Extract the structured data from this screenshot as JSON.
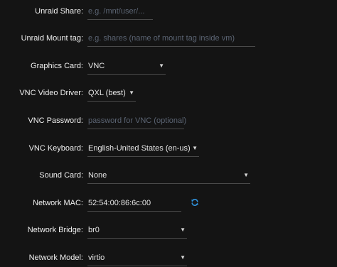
{
  "form": {
    "unraid_share": {
      "label": "Unraid Share:",
      "placeholder": "e.g. /mnt/user/..."
    },
    "unraid_mount_tag": {
      "label": "Unraid Mount tag:",
      "placeholder": "e.g. shares (name of mount tag inside vm)"
    },
    "graphics_card": {
      "label": "Graphics Card:",
      "value": "VNC"
    },
    "vnc_video_driver": {
      "label": "VNC Video Driver:",
      "value": "QXL (best)"
    },
    "vnc_password": {
      "label": "VNC Password:",
      "placeholder": "password for VNC (optional)"
    },
    "vnc_keyboard": {
      "label": "VNC Keyboard:",
      "value": "English-United States (en-us)"
    },
    "sound_card": {
      "label": "Sound Card:",
      "value": "None"
    },
    "network_mac": {
      "label": "Network MAC:",
      "value": "52:54:00:86:6c:00",
      "refresh_icon": "refresh-icon"
    },
    "network_bridge": {
      "label": "Network Bridge:",
      "value": "br0"
    },
    "network_model": {
      "label": "Network Model:",
      "value": "virtio"
    }
  },
  "colors": {
    "background": "#141414",
    "accent": "#2f8fd8",
    "placeholder": "#5b6473"
  }
}
